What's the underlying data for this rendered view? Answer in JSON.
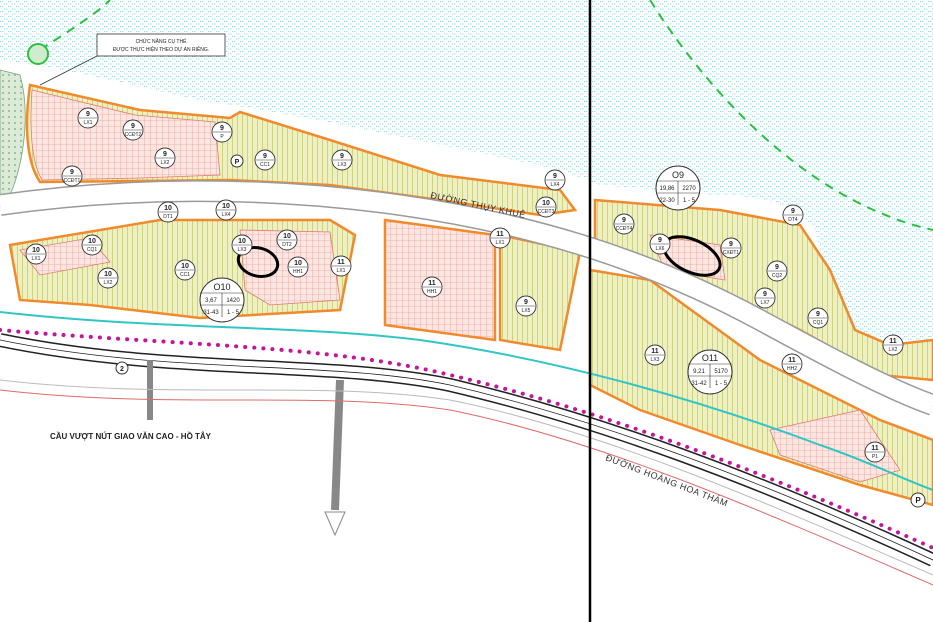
{
  "note": {
    "line1": "CHỨC NĂNG CỤ THỂ",
    "line2": "ĐƯỢC THỰC HIỆN THEO DỰ ÁN RIÊNG."
  },
  "labels": {
    "bridge": "CẦU VƯỢT NÚT GIAO VĂN CAO - HỒ TÂY"
  },
  "roads": {
    "thuy_khue": "ĐƯỜNG THỤY KHUÊ",
    "hoang_hoa_tham": "ĐƯỜNG HOÀNG HOA THÁM"
  },
  "route_marker": "2",
  "parking_symbol": "P",
  "blocks": {
    "O10": {
      "name": "O10",
      "area": "3,67",
      "pop": "1420",
      "height": "31-43",
      "floors": "1 - 5"
    },
    "O11": {
      "name": "O11",
      "area": "9,21",
      "pop": "5170",
      "height": "31-42",
      "floors": "1 - 5"
    },
    "O9": {
      "name": "O9",
      "area": "19,86",
      "pop": "2270",
      "height": "22-30",
      "floors": "1 - 5"
    }
  },
  "parcels": [
    {
      "n": "9",
      "c": "LX1"
    },
    {
      "n": "9",
      "c": "CCĐT2"
    },
    {
      "n": "9",
      "c": "LX2"
    },
    {
      "n": "9",
      "c": "CCĐT1"
    },
    {
      "n": "9",
      "c": "P"
    },
    {
      "n": "9",
      "c": "CC1"
    },
    {
      "n": "9",
      "c": "LX3"
    },
    {
      "n": "9",
      "c": "LX4"
    },
    {
      "n": "10",
      "c": "CCĐT3"
    },
    {
      "n": "10",
      "c": "DT1"
    },
    {
      "n": "10",
      "c": "LX4"
    },
    {
      "n": "10",
      "c": "LX1"
    },
    {
      "n": "10",
      "c": "CQ1"
    },
    {
      "n": "10",
      "c": "LX2"
    },
    {
      "n": "10",
      "c": "CC1"
    },
    {
      "n": "10",
      "c": "LX3"
    },
    {
      "n": "10",
      "c": "DT2"
    },
    {
      "n": "10",
      "c": "HH1"
    },
    {
      "n": "11",
      "c": "LX1"
    },
    {
      "n": "11",
      "c": "HH1"
    },
    {
      "n": "11",
      "c": "LX1"
    },
    {
      "n": "9",
      "c": "LX5"
    },
    {
      "n": "9",
      "c": "CCĐT4"
    },
    {
      "n": "9",
      "c": "LX6"
    },
    {
      "n": "9",
      "c": "CXĐT1"
    },
    {
      "n": "9",
      "c": "DT4"
    },
    {
      "n": "9",
      "c": "CQ2"
    },
    {
      "n": "9",
      "c": "LX7"
    },
    {
      "n": "9",
      "c": "CQ1"
    },
    {
      "n": "11",
      "c": "LX2"
    },
    {
      "n": "11",
      "c": "LX3"
    },
    {
      "n": "11",
      "c": "HH2"
    },
    {
      "n": "11",
      "c": "P1"
    }
  ]
}
